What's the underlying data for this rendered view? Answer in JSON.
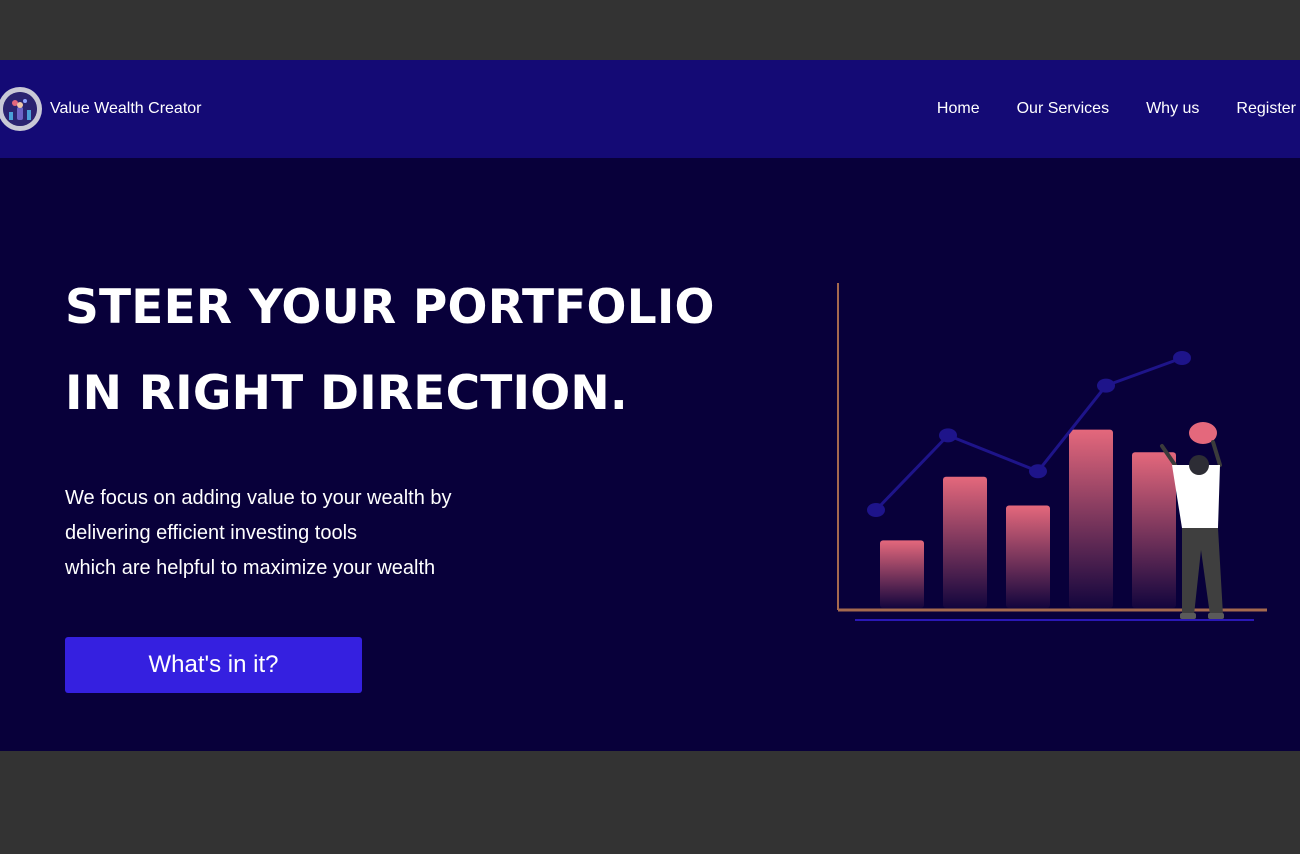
{
  "brand": {
    "name": "Value Wealth Creator"
  },
  "nav": {
    "items": [
      "Home",
      "Our Services",
      "Why us",
      "Register"
    ]
  },
  "hero": {
    "title_line1": "STEER YOUR PORTFOLIO",
    "title_line2": "IN RIGHT DIRECTION.",
    "description": [
      "We focus on adding value to your wealth by",
      "delivering efficient investing tools",
      "which are helpful to maximize your wealth"
    ],
    "cta_label": "What's in it?"
  },
  "illustration": {
    "bars": [
      0.33,
      0.64,
      0.5,
      0.87,
      0.76
    ],
    "line_points": [
      0.45,
      0.72,
      0.59,
      0.9,
      1.0
    ]
  },
  "colors": {
    "background": "#08003a",
    "navbar": "#140a75",
    "button": "#3520e0",
    "bar_top": "#e4687c",
    "axis": "#a4694e",
    "line": "#1e148a"
  }
}
